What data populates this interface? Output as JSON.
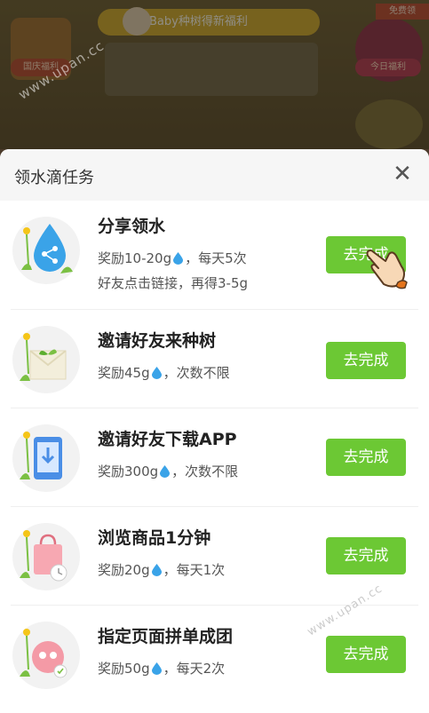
{
  "background": {
    "banner_text": "Baby种树得新福利",
    "left_label": "国庆福利",
    "right_label": "今日福利",
    "badge": "免费领"
  },
  "watermark": {
    "top": "www.upan.cc",
    "bottom": "www.upan.cc"
  },
  "sheet": {
    "title": "领水滴任务",
    "close_icon": "close-icon",
    "button_label": "去完成",
    "tasks": [
      {
        "title": "分享领水",
        "reward": "奖励10-20g",
        "freq": "，每天5次",
        "extra": "好友点击链接，再得3-5g",
        "icon": "share-drop-icon"
      },
      {
        "title": "邀请好友来种树",
        "reward": "奖励45g",
        "freq": "，次数不限",
        "icon": "envelope-sprout-icon"
      },
      {
        "title": "邀请好友下载APP",
        "reward": "奖励300g",
        "freq": "，次数不限",
        "icon": "phone-download-icon"
      },
      {
        "title": "浏览商品1分钟",
        "reward": "奖励20g",
        "freq": "，每天1次",
        "icon": "shopping-bag-timer-icon"
      },
      {
        "title": "指定页面拼单成团",
        "reward": "奖励50g",
        "freq": "，每天2次",
        "icon": "group-order-icon"
      }
    ]
  },
  "colors": {
    "accent_green": "#6cc834",
    "drop_blue": "#3aa3e8"
  }
}
